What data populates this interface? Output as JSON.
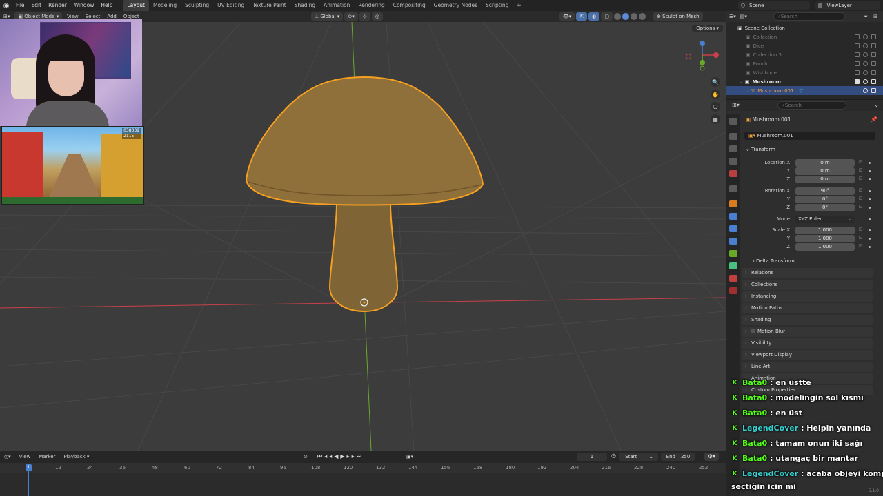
{
  "menu": {
    "items": [
      "File",
      "Edit",
      "Render",
      "Window",
      "Help"
    ],
    "workspaces": [
      "Layout",
      "Modeling",
      "Sculpting",
      "UV Editing",
      "Texture Paint",
      "Shading",
      "Animation",
      "Rendering",
      "Compositing",
      "Geometry Nodes",
      "Scripting"
    ],
    "active_workspace": "Layout",
    "scene": "Scene",
    "view_layer": "ViewLayer",
    "search_placeholder": "Search"
  },
  "viewport_header": {
    "mode": "Object Mode",
    "menus": [
      "View",
      "Select",
      "Add",
      "Object"
    ],
    "orientation": "Global",
    "sculpt_button": "Sculpt on Mesh",
    "options": "Options"
  },
  "outliner": {
    "root": "Scene Collection",
    "items": [
      {
        "label": "Collection",
        "style": "dim"
      },
      {
        "label": "Dice",
        "style": "dim"
      },
      {
        "label": "Collection 3",
        "style": "dim"
      },
      {
        "label": "Pouch",
        "style": "dim"
      },
      {
        "label": "Wishbone",
        "style": "dim"
      },
      {
        "label": "Mushroom",
        "style": "strong"
      },
      {
        "label": "Mushroom.001",
        "style": "selected"
      }
    ]
  },
  "properties": {
    "search_placeholder": "Search",
    "object_title": "Mushroom.001",
    "object_name": "Mushroom.001",
    "transform_title": "Transform",
    "location": {
      "label": "Location X",
      "x": "0 m",
      "y": "0 m",
      "z": "0 m"
    },
    "rotation": {
      "label": "Rotation X",
      "x": "90°",
      "y": "0°",
      "z": "0°"
    },
    "mode": {
      "label": "Mode",
      "value": "XYZ Euler"
    },
    "scale": {
      "label": "Scale X",
      "x": "1.000",
      "y": "1.000",
      "z": "1.000"
    },
    "axis_y": "Y",
    "axis_z": "Z",
    "delta_transform": "Delta Transform",
    "panels": [
      "Relations",
      "Collections",
      "Instancing",
      "Motion Paths",
      "Shading",
      "Motion Blur",
      "Visibility",
      "Viewport Display",
      "Line Art",
      "Animation",
      "Custom Properties"
    ]
  },
  "timeline": {
    "menus": [
      "View",
      "Marker",
      "Playback"
    ],
    "current_frame": "1",
    "start_label": "Start",
    "start": "1",
    "end_label": "End",
    "end": "250",
    "ticks": [
      "12",
      "24",
      "36",
      "48",
      "60",
      "72",
      "84",
      "96",
      "108",
      "120",
      "132",
      "144",
      "156",
      "168",
      "180",
      "192",
      "204",
      "216",
      "228",
      "240",
      "252"
    ],
    "playhead": "1"
  },
  "game_overlay": {
    "score": "038339",
    "coins": "2115"
  },
  "chat": [
    {
      "user": "Bata0",
      "text": " : en üstte",
      "color": "green"
    },
    {
      "user": "Bata0",
      "text": " : modelingin sol kısmı",
      "color": "green"
    },
    {
      "user": "Bata0",
      "text": " : en üst",
      "color": "green"
    },
    {
      "user": "LegendCover",
      "text": " : Helpin yanında",
      "color": "cyan"
    },
    {
      "user": "Bata0",
      "text": " : tamam onun iki sağı",
      "color": "green"
    },
    {
      "user": "Bata0",
      "text": " : utangaç bir mantar",
      "color": "green"
    },
    {
      "user": "LegendCover",
      "text": " : acaba objeyi komple",
      "color": "cyan"
    },
    {
      "user": "",
      "text": "seçtiğin için mi",
      "color": "none"
    }
  ],
  "version": "5.1.0",
  "colors": {
    "selection_outline": "#f5a020",
    "x_axis": "#c8404a",
    "y_axis": "#6aa82a",
    "mushroom_cap": "#8f6f3a",
    "chat_green": "#53fc18",
    "chat_cyan": "#36d1d1"
  }
}
